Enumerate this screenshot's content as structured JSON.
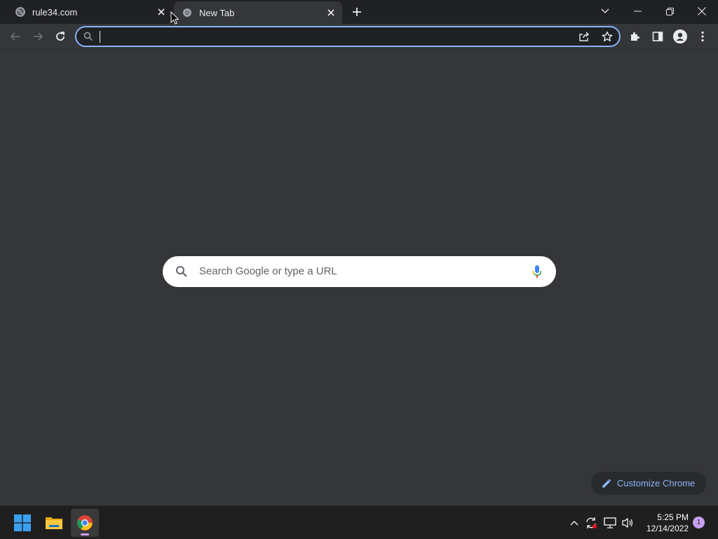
{
  "browser": {
    "tabs": [
      {
        "title": "rule34.com",
        "favicon": "globe-icon",
        "active": false
      },
      {
        "title": "New Tab",
        "favicon": "chrome-icon",
        "active": true
      }
    ],
    "omnibox": {
      "value": "",
      "placeholder": ""
    },
    "accent": "#8ab4f8"
  },
  "ntp": {
    "search_placeholder": "Search Google or type a URL",
    "customize_label": "Customize Chrome"
  },
  "taskbar": {
    "apps": [
      "windows-start-icon",
      "file-explorer-icon",
      "chrome-icon"
    ],
    "time": "5:25 PM",
    "date": "12/14/2022",
    "notification_count": "1"
  }
}
